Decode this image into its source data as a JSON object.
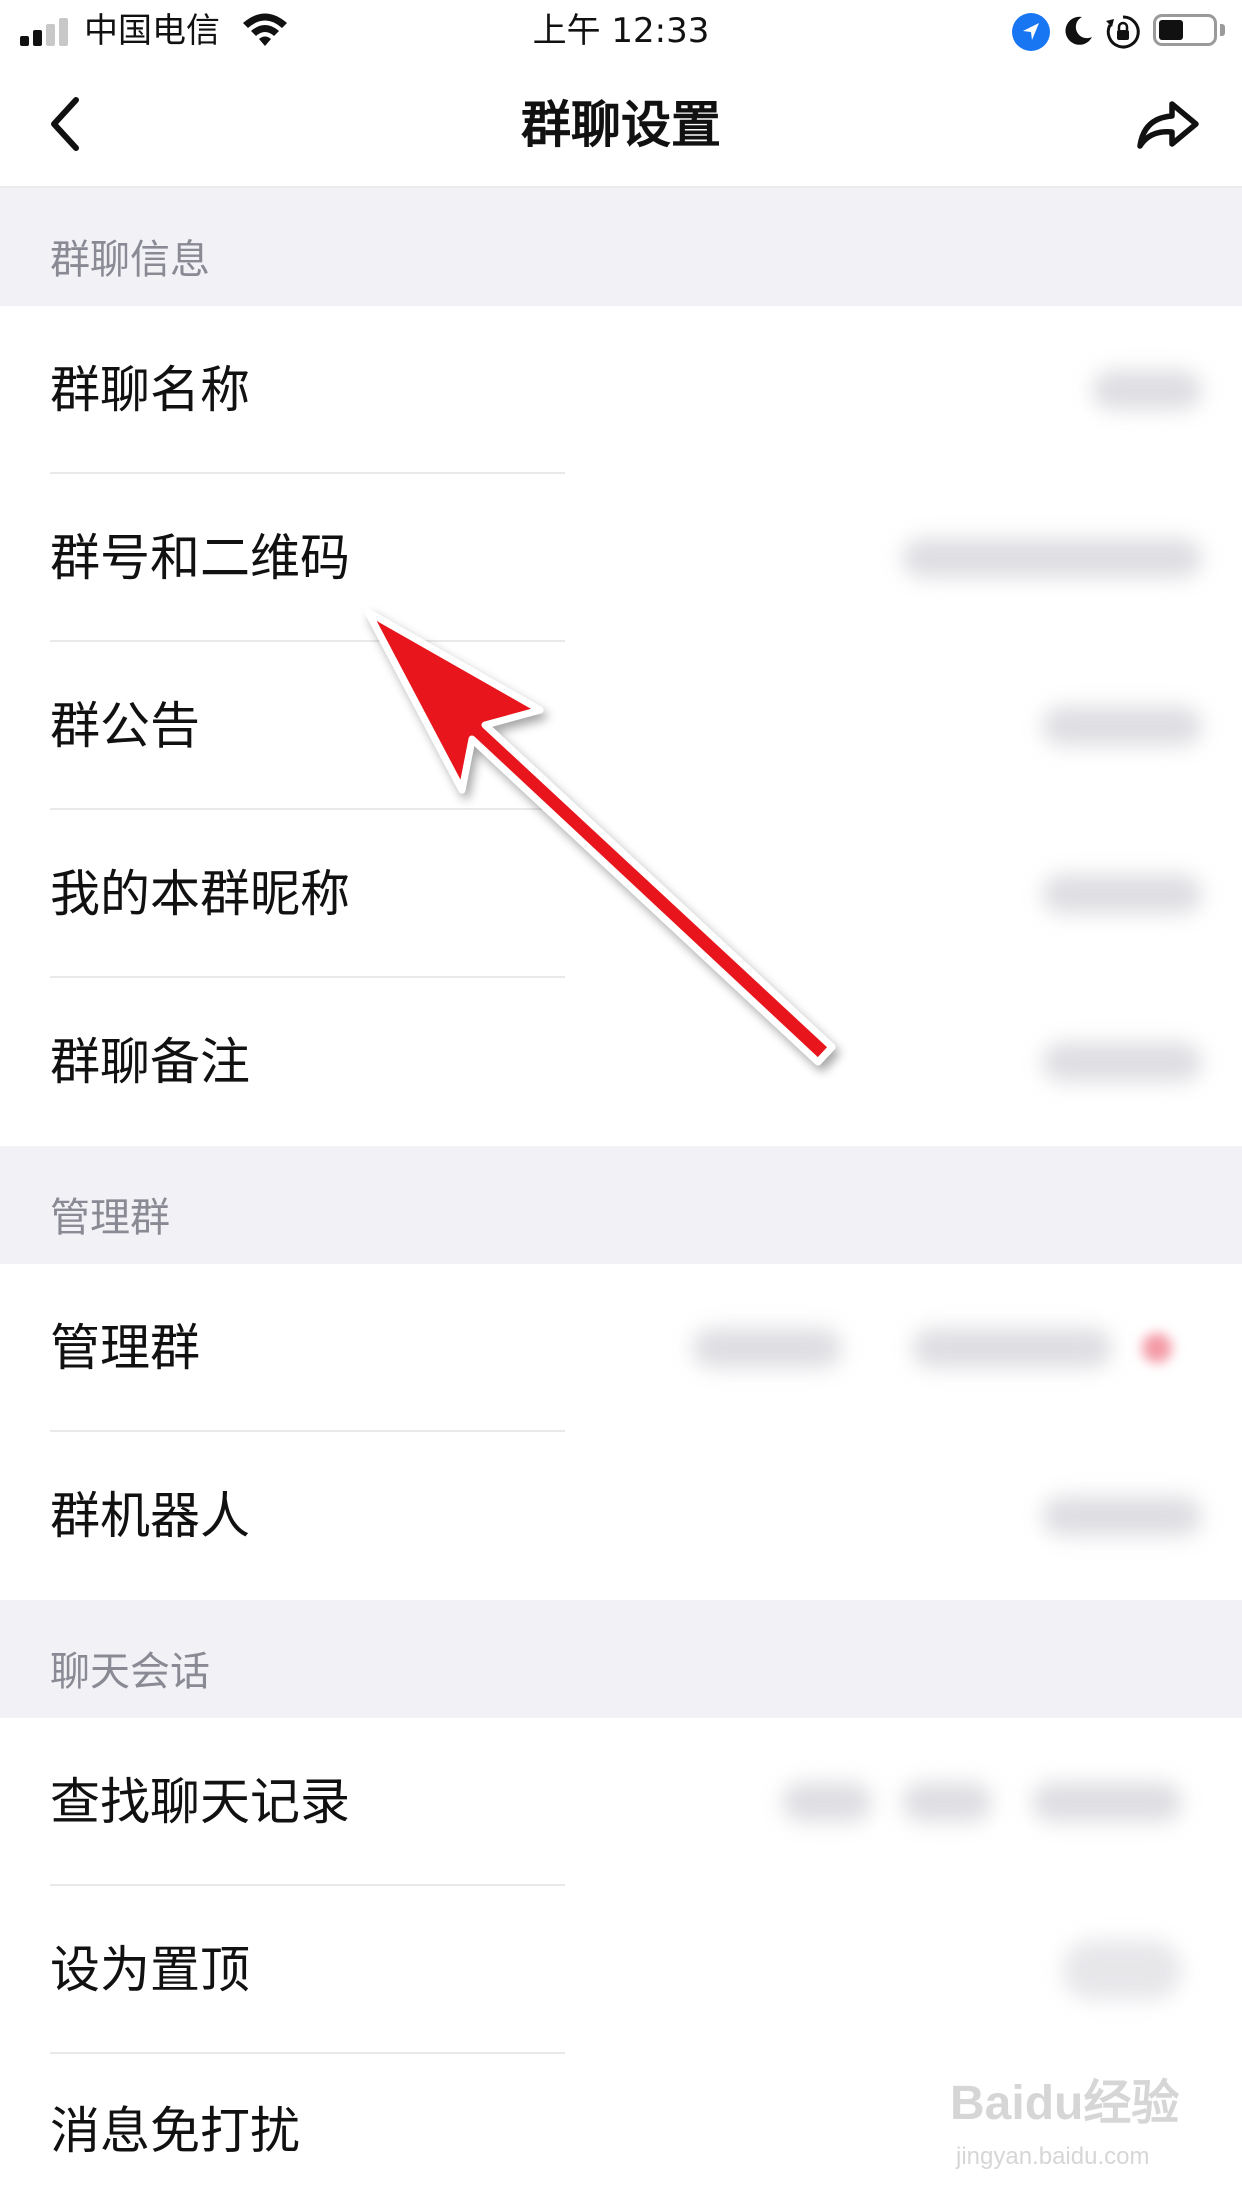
{
  "status_bar": {
    "carrier": "中国电信",
    "time": "上午 12:33"
  },
  "nav": {
    "title": "群聊设置"
  },
  "sections": [
    {
      "header": "群聊信息",
      "items": [
        "群聊名称",
        "群号和二维码",
        "群公告",
        "我的本群昵称",
        "群聊备注"
      ]
    },
    {
      "header": "管理群",
      "items": [
        "管理群",
        "群机器人"
      ]
    },
    {
      "header": "聊天会话",
      "items": [
        "查找聊天记录",
        "设为置顶",
        "消息免打扰"
      ]
    }
  ],
  "watermark": {
    "logo": "Baidu经验",
    "url": "jingyan.baidu.com"
  },
  "colors": {
    "accent_arrow": "#e8141b",
    "location_icon": "#1976f2",
    "section_bg": "#f2f2f6"
  }
}
